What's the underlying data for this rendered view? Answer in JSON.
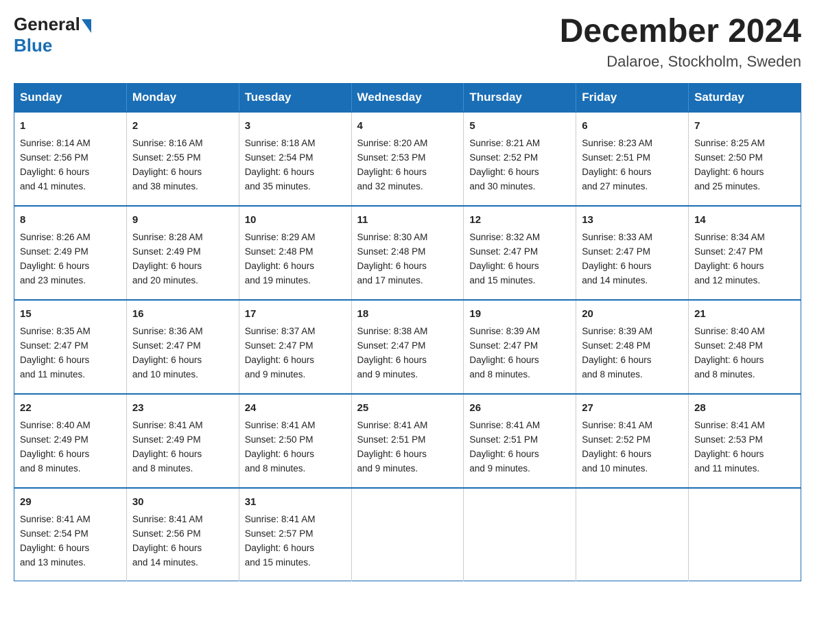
{
  "header": {
    "logo_general": "General",
    "logo_blue": "Blue",
    "month_title": "December 2024",
    "location": "Dalaroe, Stockholm, Sweden"
  },
  "days_of_week": [
    "Sunday",
    "Monday",
    "Tuesday",
    "Wednesday",
    "Thursday",
    "Friday",
    "Saturday"
  ],
  "weeks": [
    [
      {
        "day": "1",
        "sunrise": "8:14 AM",
        "sunset": "2:56 PM",
        "daylight": "6 hours and 41 minutes."
      },
      {
        "day": "2",
        "sunrise": "8:16 AM",
        "sunset": "2:55 PM",
        "daylight": "6 hours and 38 minutes."
      },
      {
        "day": "3",
        "sunrise": "8:18 AM",
        "sunset": "2:54 PM",
        "daylight": "6 hours and 35 minutes."
      },
      {
        "day": "4",
        "sunrise": "8:20 AM",
        "sunset": "2:53 PM",
        "daylight": "6 hours and 32 minutes."
      },
      {
        "day": "5",
        "sunrise": "8:21 AM",
        "sunset": "2:52 PM",
        "daylight": "6 hours and 30 minutes."
      },
      {
        "day": "6",
        "sunrise": "8:23 AM",
        "sunset": "2:51 PM",
        "daylight": "6 hours and 27 minutes."
      },
      {
        "day": "7",
        "sunrise": "8:25 AM",
        "sunset": "2:50 PM",
        "daylight": "6 hours and 25 minutes."
      }
    ],
    [
      {
        "day": "8",
        "sunrise": "8:26 AM",
        "sunset": "2:49 PM",
        "daylight": "6 hours and 23 minutes."
      },
      {
        "day": "9",
        "sunrise": "8:28 AM",
        "sunset": "2:49 PM",
        "daylight": "6 hours and 20 minutes."
      },
      {
        "day": "10",
        "sunrise": "8:29 AM",
        "sunset": "2:48 PM",
        "daylight": "6 hours and 19 minutes."
      },
      {
        "day": "11",
        "sunrise": "8:30 AM",
        "sunset": "2:48 PM",
        "daylight": "6 hours and 17 minutes."
      },
      {
        "day": "12",
        "sunrise": "8:32 AM",
        "sunset": "2:47 PM",
        "daylight": "6 hours and 15 minutes."
      },
      {
        "day": "13",
        "sunrise": "8:33 AM",
        "sunset": "2:47 PM",
        "daylight": "6 hours and 14 minutes."
      },
      {
        "day": "14",
        "sunrise": "8:34 AM",
        "sunset": "2:47 PM",
        "daylight": "6 hours and 12 minutes."
      }
    ],
    [
      {
        "day": "15",
        "sunrise": "8:35 AM",
        "sunset": "2:47 PM",
        "daylight": "6 hours and 11 minutes."
      },
      {
        "day": "16",
        "sunrise": "8:36 AM",
        "sunset": "2:47 PM",
        "daylight": "6 hours and 10 minutes."
      },
      {
        "day": "17",
        "sunrise": "8:37 AM",
        "sunset": "2:47 PM",
        "daylight": "6 hours and 9 minutes."
      },
      {
        "day": "18",
        "sunrise": "8:38 AM",
        "sunset": "2:47 PM",
        "daylight": "6 hours and 9 minutes."
      },
      {
        "day": "19",
        "sunrise": "8:39 AM",
        "sunset": "2:47 PM",
        "daylight": "6 hours and 8 minutes."
      },
      {
        "day": "20",
        "sunrise": "8:39 AM",
        "sunset": "2:48 PM",
        "daylight": "6 hours and 8 minutes."
      },
      {
        "day": "21",
        "sunrise": "8:40 AM",
        "sunset": "2:48 PM",
        "daylight": "6 hours and 8 minutes."
      }
    ],
    [
      {
        "day": "22",
        "sunrise": "8:40 AM",
        "sunset": "2:49 PM",
        "daylight": "6 hours and 8 minutes."
      },
      {
        "day": "23",
        "sunrise": "8:41 AM",
        "sunset": "2:49 PM",
        "daylight": "6 hours and 8 minutes."
      },
      {
        "day": "24",
        "sunrise": "8:41 AM",
        "sunset": "2:50 PM",
        "daylight": "6 hours and 8 minutes."
      },
      {
        "day": "25",
        "sunrise": "8:41 AM",
        "sunset": "2:51 PM",
        "daylight": "6 hours and 9 minutes."
      },
      {
        "day": "26",
        "sunrise": "8:41 AM",
        "sunset": "2:51 PM",
        "daylight": "6 hours and 9 minutes."
      },
      {
        "day": "27",
        "sunrise": "8:41 AM",
        "sunset": "2:52 PM",
        "daylight": "6 hours and 10 minutes."
      },
      {
        "day": "28",
        "sunrise": "8:41 AM",
        "sunset": "2:53 PM",
        "daylight": "6 hours and 11 minutes."
      }
    ],
    [
      {
        "day": "29",
        "sunrise": "8:41 AM",
        "sunset": "2:54 PM",
        "daylight": "6 hours and 13 minutes."
      },
      {
        "day": "30",
        "sunrise": "8:41 AM",
        "sunset": "2:56 PM",
        "daylight": "6 hours and 14 minutes."
      },
      {
        "day": "31",
        "sunrise": "8:41 AM",
        "sunset": "2:57 PM",
        "daylight": "6 hours and 15 minutes."
      },
      null,
      null,
      null,
      null
    ]
  ],
  "labels": {
    "sunrise": "Sunrise:",
    "sunset": "Sunset:",
    "daylight": "Daylight:"
  }
}
